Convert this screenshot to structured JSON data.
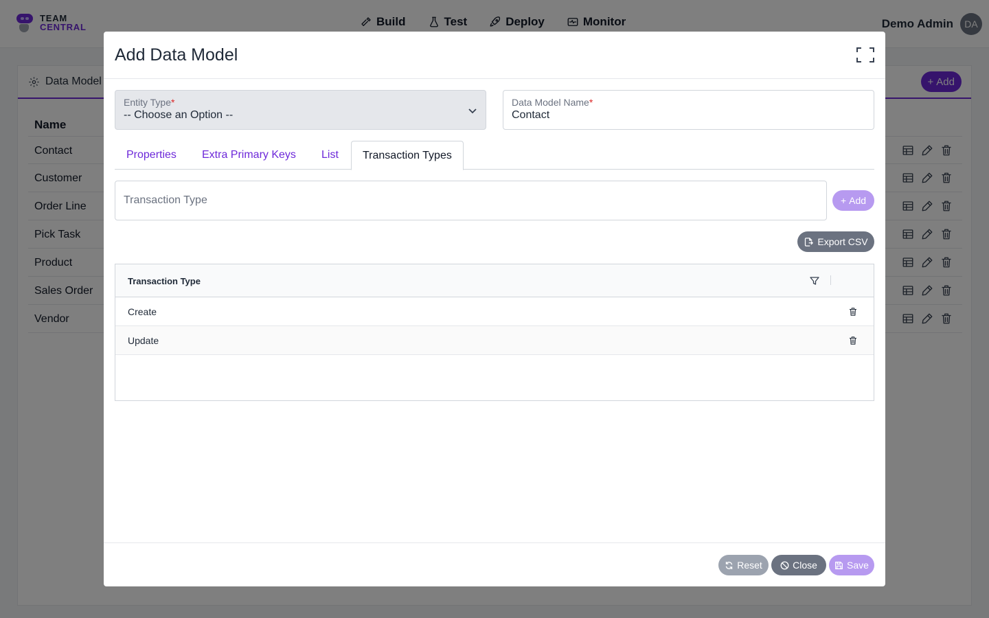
{
  "app": {
    "logo_line1": "TEAM",
    "logo_line2": "CENTRAL",
    "nav": [
      {
        "label": "Build",
        "icon": "hammer-icon"
      },
      {
        "label": "Test",
        "icon": "flask-icon"
      },
      {
        "label": "Deploy",
        "icon": "rocket-icon"
      },
      {
        "label": "Monitor",
        "icon": "monitor-icon"
      }
    ],
    "user_name": "Demo Admin",
    "user_initials": "DA"
  },
  "background_panel": {
    "title": "Data Model",
    "add_label": "Add",
    "column_name": "Name",
    "rows": [
      "Contact",
      "Customer",
      "Order Line",
      "Pick Task",
      "Product",
      "Sales Order",
      "Vendor"
    ]
  },
  "modal": {
    "title": "Add Data Model",
    "entity_type": {
      "label": "Entity Type",
      "required_mark": "*",
      "value": "-- Choose an Option --"
    },
    "data_model_name": {
      "label": "Data Model Name",
      "required_mark": "*",
      "value": "Contact"
    },
    "tabs": [
      {
        "label": "Properties",
        "active": false
      },
      {
        "label": "Extra Primary Keys",
        "active": false
      },
      {
        "label": "List",
        "active": false
      },
      {
        "label": "Transaction Types",
        "active": true
      }
    ],
    "transaction_input": {
      "placeholder": "Transaction Type",
      "value": ""
    },
    "add_label": "Add",
    "export_label": "Export CSV",
    "grid": {
      "column_header": "Transaction Type",
      "rows": [
        "Create",
        "Update"
      ]
    },
    "footer": {
      "reset_label": "Reset",
      "close_label": "Close",
      "save_label": "Save"
    }
  },
  "colors": {
    "accent": "#6d28d9",
    "accent_light": "#b79af0",
    "secondary": "#6b7280",
    "required": "#dc2626"
  }
}
